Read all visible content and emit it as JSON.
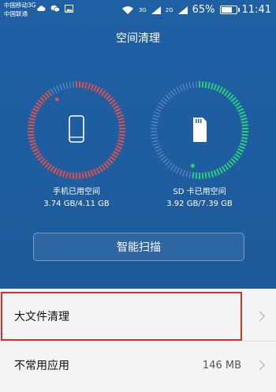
{
  "status_bar": {
    "carrier_line1": "中国移动3G",
    "carrier_line2": "中国联通",
    "net_3g": "3G",
    "net_2g": "2G",
    "battery_percent": "65%",
    "time": "11:41",
    "icons": [
      "cloud-icon",
      "wechat-icon",
      "image-icon",
      "wifi-icon",
      "signal-icon",
      "battery-icon"
    ]
  },
  "header": {
    "title": "空间清理"
  },
  "gauges": [
    {
      "label": "手机已用空间",
      "value": "3.74 GB/4.11 GB",
      "used_fraction": 0.91,
      "color": "#e0514d",
      "icon": "phone-icon"
    },
    {
      "label": "SD 卡已用空间",
      "value": "3.92 GB/7.39 GB",
      "used_fraction": 0.53,
      "color": "#29d277",
      "icon": "sd-card-icon"
    }
  ],
  "scan_button": {
    "label": "智能扫描"
  },
  "list": {
    "items": [
      {
        "label": "大文件清理",
        "value": ""
      },
      {
        "label": "不常用应用",
        "value": "146 MB"
      }
    ]
  },
  "colors": {
    "header_bg": "#1f5fa3",
    "highlight": "#d4312c",
    "track": "#7d9fd0"
  }
}
